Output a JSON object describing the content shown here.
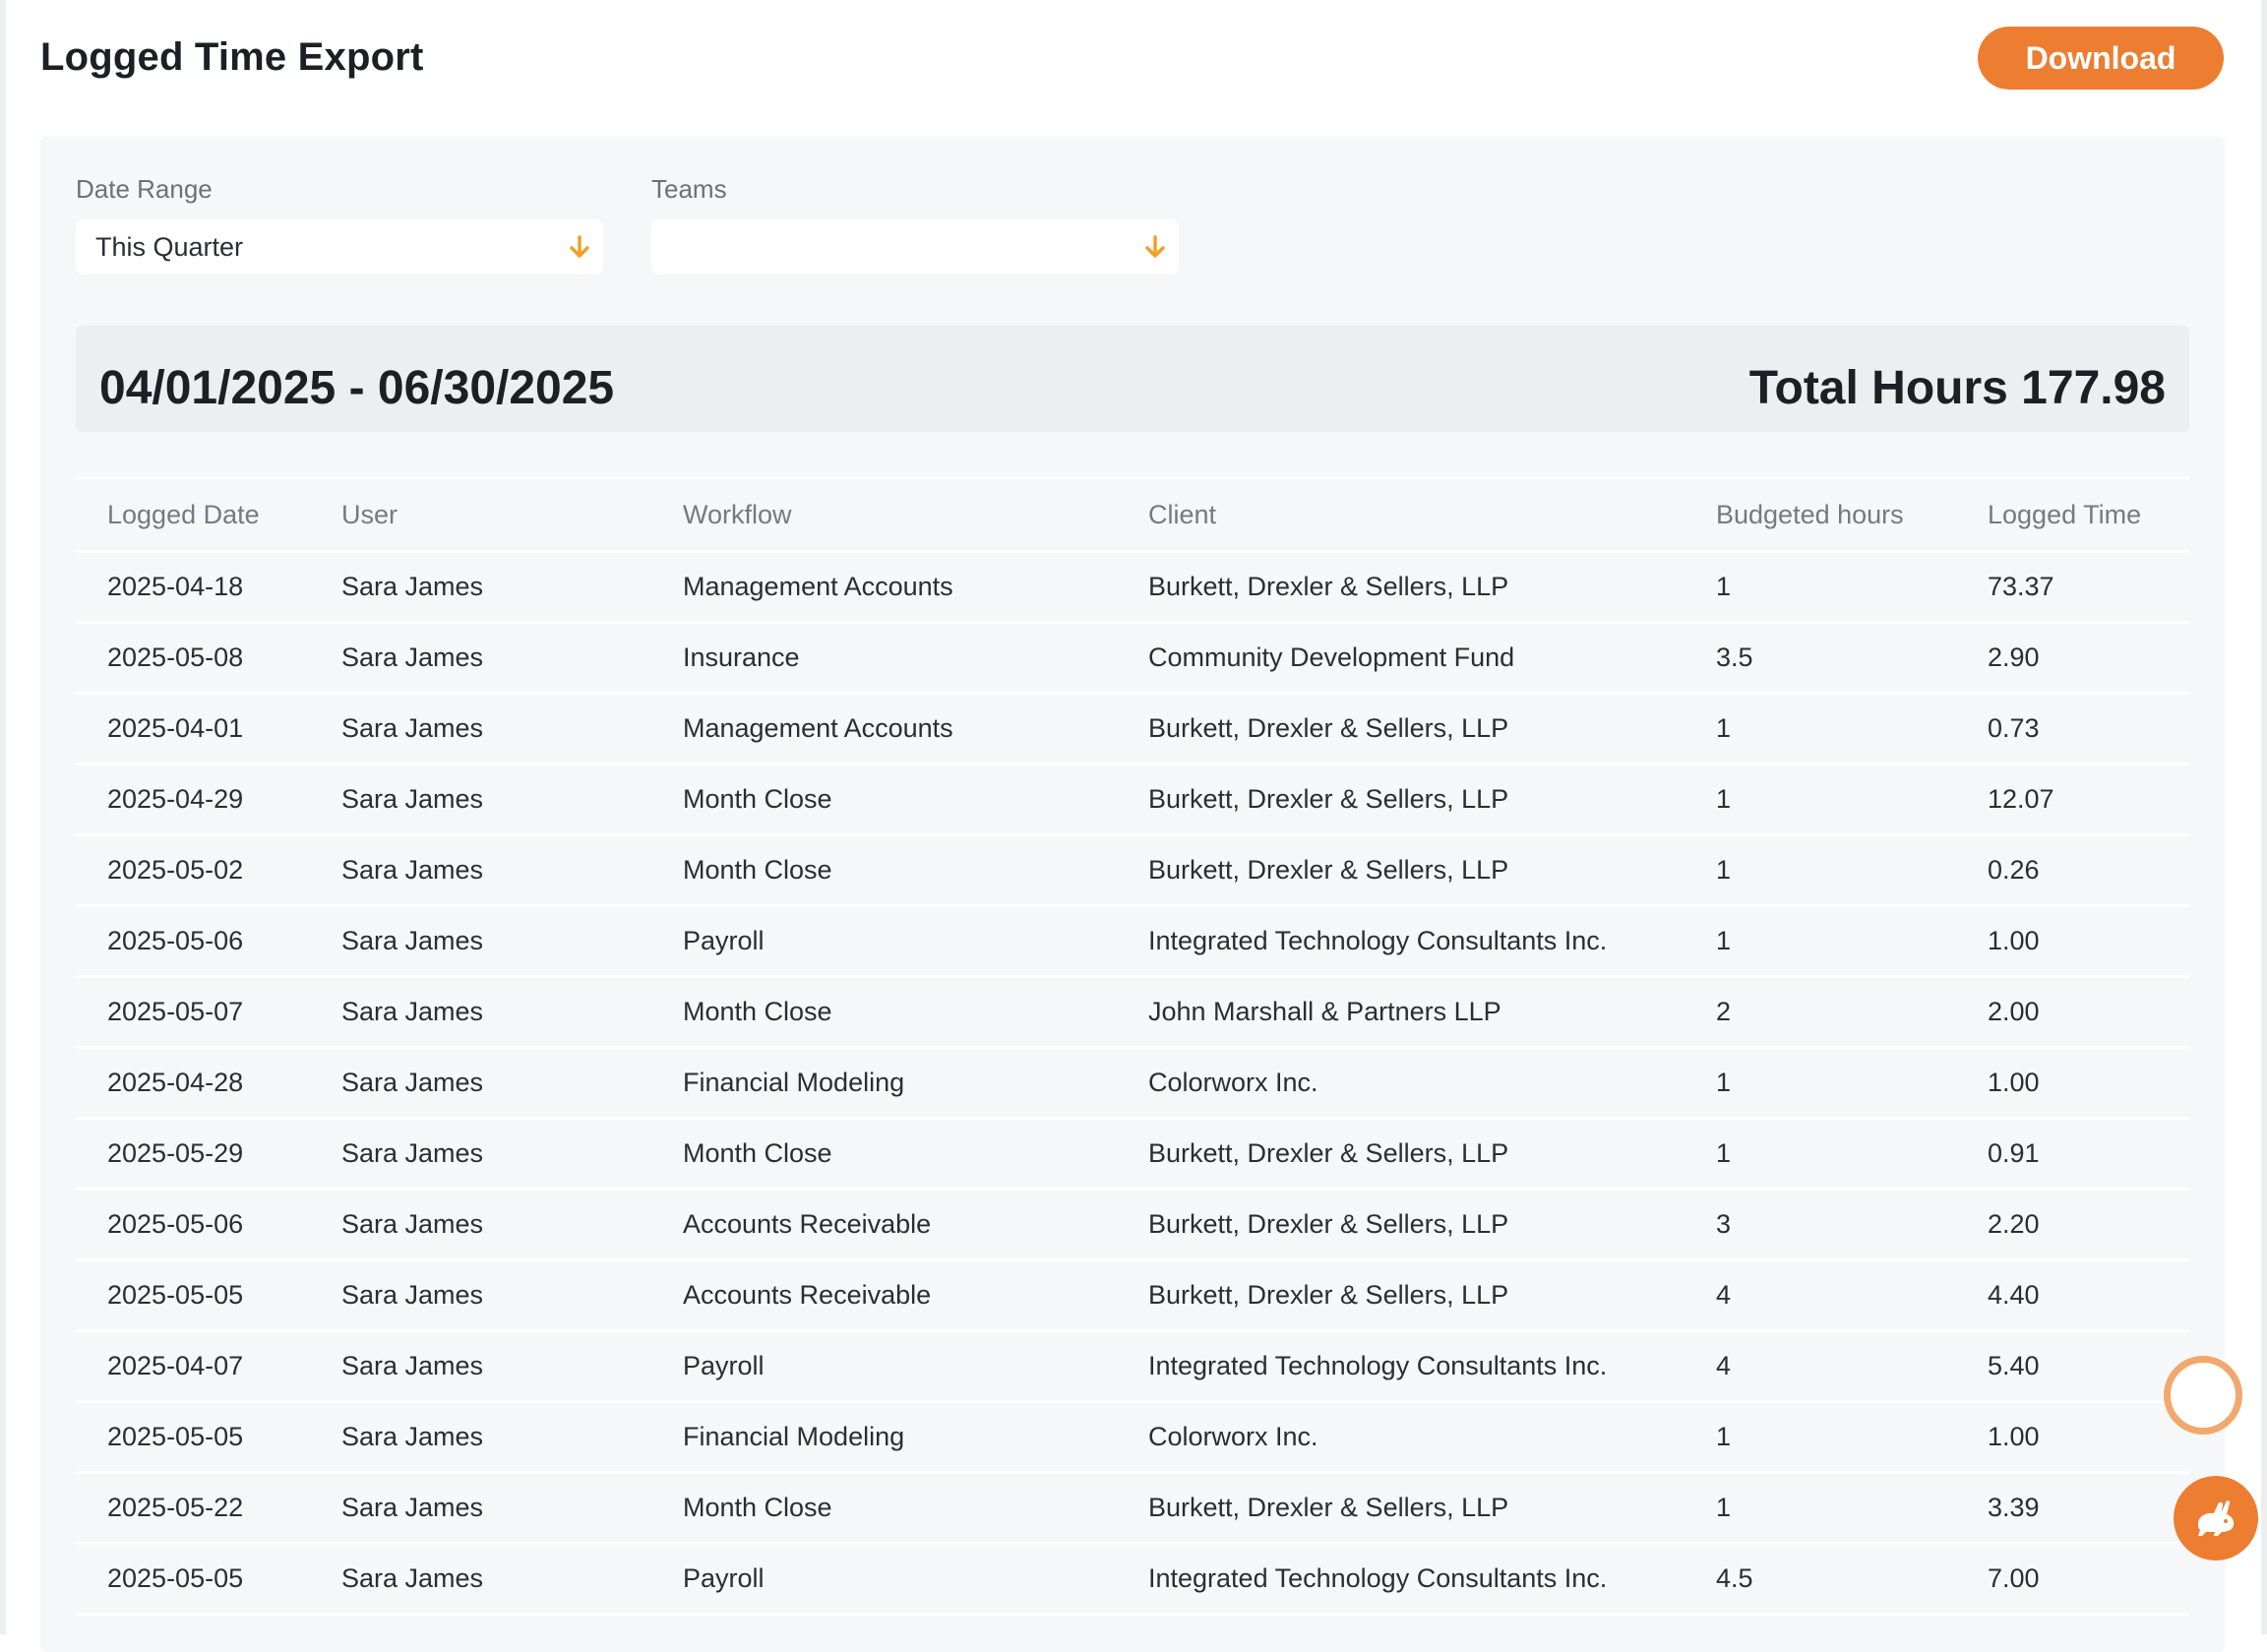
{
  "header": {
    "title": "Logged Time Export",
    "download_label": "Download"
  },
  "filters": {
    "date_range": {
      "label": "Date Range",
      "value": "This Quarter"
    },
    "teams": {
      "label": "Teams",
      "value": ""
    }
  },
  "summary": {
    "range": "04/01/2025 - 06/30/2025",
    "total": "Total Hours 177.98"
  },
  "table": {
    "headers": [
      "Logged Date",
      "User",
      "Workflow",
      "Client",
      "Budgeted hours",
      "Logged Time"
    ],
    "rows": [
      [
        "2025-04-18",
        "Sara James",
        "Management Accounts",
        "Burkett, Drexler & Sellers, LLP",
        "1",
        "73.37"
      ],
      [
        "2025-05-08",
        "Sara James",
        "Insurance",
        "Community Development Fund",
        "3.5",
        "2.90"
      ],
      [
        "2025-04-01",
        "Sara James",
        "Management Accounts",
        "Burkett, Drexler & Sellers, LLP",
        "1",
        "0.73"
      ],
      [
        "2025-04-29",
        "Sara James",
        "Month Close",
        "Burkett, Drexler & Sellers, LLP",
        "1",
        "12.07"
      ],
      [
        "2025-05-02",
        "Sara James",
        "Month Close",
        "Burkett, Drexler & Sellers, LLP",
        "1",
        "0.26"
      ],
      [
        "2025-05-06",
        "Sara James",
        "Payroll",
        "Integrated Technology Consultants Inc.",
        "1",
        "1.00"
      ],
      [
        "2025-05-07",
        "Sara James",
        "Month Close",
        "John Marshall & Partners LLP",
        "2",
        "2.00"
      ],
      [
        "2025-04-28",
        "Sara James",
        "Financial Modeling",
        "Colorworx Inc.",
        "1",
        "1.00"
      ],
      [
        "2025-05-29",
        "Sara James",
        "Month Close",
        "Burkett, Drexler & Sellers, LLP",
        "1",
        "0.91"
      ],
      [
        "2025-05-06",
        "Sara James",
        "Accounts Receivable",
        "Burkett, Drexler & Sellers, LLP",
        "3",
        "2.20"
      ],
      [
        "2025-05-05",
        "Sara James",
        "Accounts Receivable",
        "Burkett, Drexler & Sellers, LLP",
        "4",
        "4.40"
      ],
      [
        "2025-04-07",
        "Sara James",
        "Payroll",
        "Integrated Technology Consultants Inc.",
        "4",
        "5.40"
      ],
      [
        "2025-05-05",
        "Sara James",
        "Financial Modeling",
        "Colorworx Inc.",
        "1",
        "1.00"
      ],
      [
        "2025-05-22",
        "Sara James",
        "Month Close",
        "Burkett, Drexler & Sellers, LLP",
        "1",
        "3.39"
      ],
      [
        "2025-05-05",
        "Sara James",
        "Payroll",
        "Integrated Technology Consultants Inc.",
        "4.5",
        "7.00"
      ]
    ]
  },
  "widgets": {
    "chat_icon": "chat-ring-icon",
    "rabbit_icon": "rabbit-icon"
  },
  "colors": {
    "accent": "#ed7d31",
    "panel_bg": "#f6f7f9"
  }
}
